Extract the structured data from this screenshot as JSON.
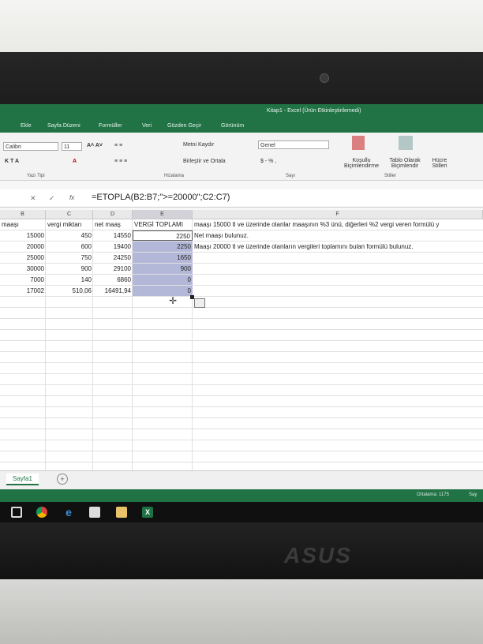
{
  "window": {
    "title": "Kitap1 - Excel (Ürün Etkinleştirilemedi)"
  },
  "ribbon_tabs": [
    "Ekle",
    "Sayfa Düzeni",
    "Formüller",
    "Veri",
    "Gözden Geçir",
    "Görünüm"
  ],
  "ribbon": {
    "font_name": "Calibri",
    "font_size": "11",
    "wrap_text": "Metni Kaydır",
    "merge_center": "Birleştir ve Ortala",
    "number_format": "Genel",
    "conditional_format": "Koşullu Biçimlendirme",
    "format_as_table": "Tablo Olarak Biçimlendir",
    "cell_styles": "Hücre Stilleri",
    "groups": {
      "font": "Yazı Tipi",
      "alignment": "Hizalama",
      "number": "Sayı",
      "styles": "Stiller"
    }
  },
  "formula_bar": {
    "fx": "fx",
    "formula": "=ETOPLA(B2:B7;\">=20000\";C2:C7)"
  },
  "columns": [
    "B",
    "C",
    "D",
    "E",
    "F"
  ],
  "headers": [
    "maaşı",
    "vergi miktarı",
    "net maaş",
    "VERGİ TOPLAMI"
  ],
  "rows": [
    {
      "b": "15000",
      "c": "450",
      "d": "14550",
      "e": "2250",
      "f": "Net maaşı bulunuz."
    },
    {
      "b": "20000",
      "c": "600",
      "d": "19400",
      "e": "2250",
      "f": "Maaşı 20000 tl ve üzerinde olanların vergileri toplamını bulan formülü bulunuz."
    },
    {
      "b": "25000",
      "c": "750",
      "d": "24250",
      "e": "1650",
      "f": ""
    },
    {
      "b": "30000",
      "c": "900",
      "d": "29100",
      "e": "900",
      "f": ""
    },
    {
      "b": "7000",
      "c": "140",
      "d": "6860",
      "e": "0",
      "f": ""
    },
    {
      "b": "17002",
      "c": "510,06",
      "d": "16491,94",
      "e": "0",
      "f": ""
    }
  ],
  "header_note": "maaşı 15000 tl ve üzerinde olanlar maaşının %3 ünü, diğerleri %2 vergi veren formülü y",
  "sheet_tab": "Sayfa1",
  "status_bar": {
    "average": "Ortalama: 1175",
    "count": "Say"
  },
  "brand": "ASUS"
}
